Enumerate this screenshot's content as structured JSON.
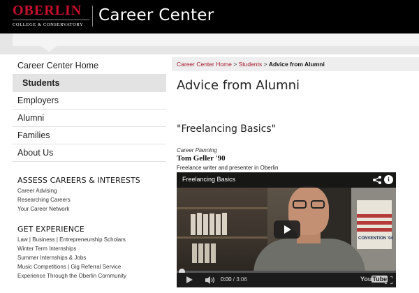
{
  "header": {
    "logo_main": "OBERLIN",
    "logo_sub": "COLLEGE & CONSERVATORY",
    "site_title": "Career Center"
  },
  "nav": {
    "items": [
      {
        "label": "Career Center Home"
      },
      {
        "label": "Students",
        "active": true
      },
      {
        "label": "Employers"
      },
      {
        "label": "Alumni"
      },
      {
        "label": "Families"
      },
      {
        "label": "About Us"
      }
    ]
  },
  "sidebar": {
    "assess": {
      "heading": "ASSESS CAREERS & INTERESTS",
      "links": [
        "Career Advising",
        "Researching Careers",
        "Your Career Network"
      ]
    },
    "experience": {
      "heading": "GET EXPERIENCE",
      "links": [
        "Law | Business | Entrepreneurship Scholars",
        "Winter Term Internships",
        "Summer Internships & Jobs",
        "Music Competitions | Gig Referral Service",
        "Experience Through the Oberlin Community"
      ]
    }
  },
  "breadcrumb": {
    "home": "Career Center Home",
    "sep": " > ",
    "students": "Students",
    "current": "Advice from Alumni"
  },
  "main": {
    "page_title": "Advice from Alumni",
    "video_title": "\"Freelancing Basics\"",
    "category": "Career Planning",
    "name": "Tom Geller '90",
    "description": "Freelance writer and presenter in Oberlin"
  },
  "player": {
    "title": "Freelancing Basics",
    "time_current": "0:00",
    "time_sep": " / ",
    "time_total": "3:06",
    "brand_you": "You",
    "brand_tube": "Tube",
    "poster_text": "CONVENTION '04",
    "progress": 0
  },
  "colors": {
    "brand_red": "#c8102e",
    "crumb_red": "#a6192e",
    "header_bg": "#000000"
  }
}
